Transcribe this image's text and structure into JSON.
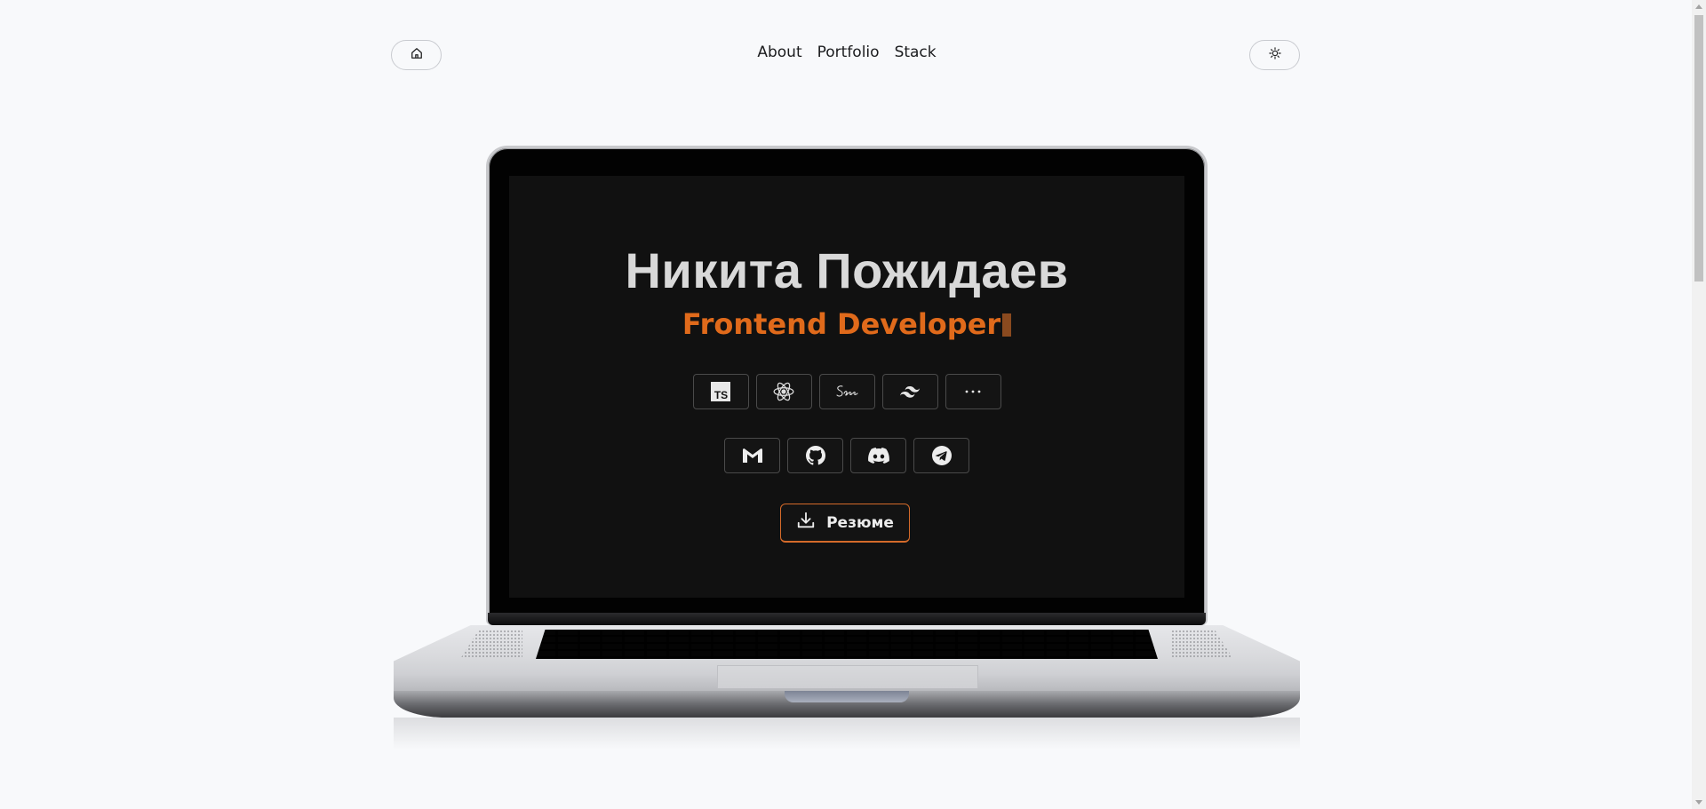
{
  "header": {
    "home_icon": "home-icon",
    "theme_icon": "sun-icon",
    "nav": [
      "About",
      "Portfolio",
      "Stack"
    ]
  },
  "hero": {
    "name": "Никита Пожидаев",
    "role": "Frontend Developer",
    "accent_color": "#e06a1b",
    "stack_icons": [
      "typescript-icon",
      "react-icon",
      "sass-icon",
      "tailwind-icon",
      "more-icon"
    ],
    "social_icons": [
      "gmail-icon",
      "github-icon",
      "discord-icon",
      "telegram-icon"
    ],
    "resume_label": "Резюме",
    "resume_icon": "download-icon"
  }
}
